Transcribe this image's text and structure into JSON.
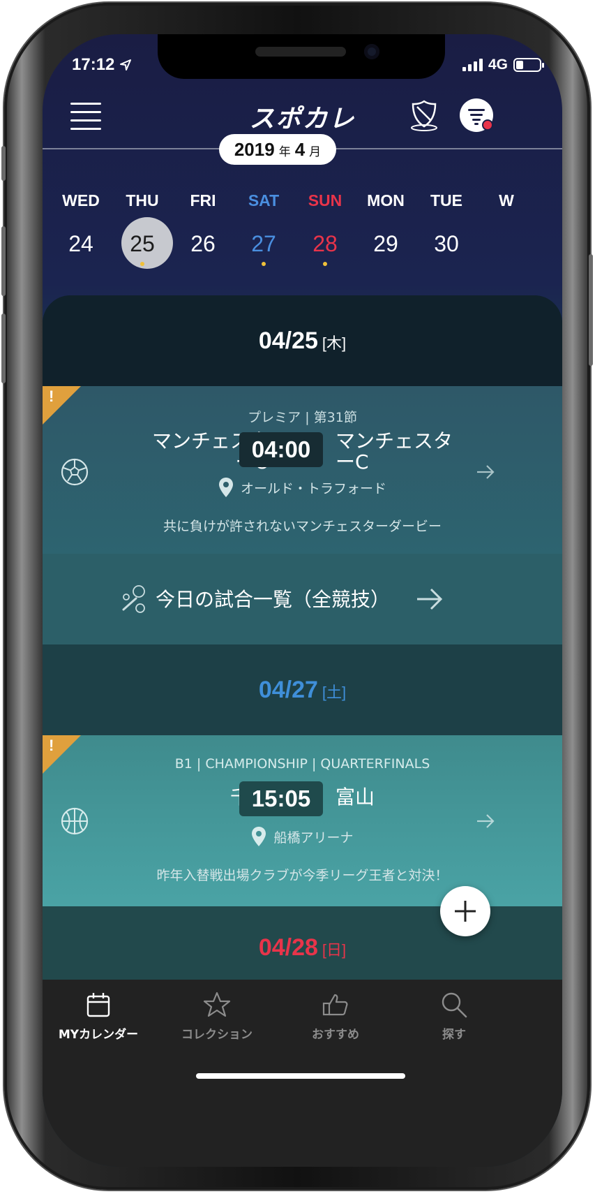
{
  "status_bar": {
    "time": "17:12",
    "network": "4G"
  },
  "header": {
    "logo": "スポカレ",
    "year": "2019",
    "year_unit": "年",
    "month": "4",
    "month_unit": "月"
  },
  "week": [
    {
      "dow": "WED",
      "num": "24",
      "dot": false,
      "type": "normal"
    },
    {
      "dow": "THU",
      "num": "25",
      "dot": true,
      "type": "selected"
    },
    {
      "dow": "FRI",
      "num": "26",
      "dot": false,
      "type": "normal"
    },
    {
      "dow": "SAT",
      "num": "27",
      "dot": true,
      "type": "sat"
    },
    {
      "dow": "SUN",
      "num": "28",
      "dot": true,
      "type": "sun"
    },
    {
      "dow": "MON",
      "num": "29",
      "dot": false,
      "type": "normal"
    },
    {
      "dow": "TUE",
      "num": "30",
      "dot": false,
      "type": "normal"
    },
    {
      "dow": "W",
      "num": "",
      "dot": false,
      "type": "normal"
    }
  ],
  "sections": [
    {
      "date": "04/25",
      "weekday": "[木]",
      "color": "#ffffff",
      "event": {
        "flag": "!",
        "league": "プレミア | 第31節",
        "home_line1": "マンチェスタ",
        "home_line2": "ーU",
        "time": "04:00",
        "away_line1": "マンチェスタ",
        "away_line2": "ーC",
        "venue": "オールド・トラフォード",
        "description": "共に負けが許されないマンチェスターダービー",
        "sport_icon": "soccer-ball-icon"
      }
    },
    {
      "date": "04/27",
      "weekday": "[土]",
      "color": "#3f8fd9",
      "event": {
        "flag": "!",
        "league": "B1 | CHAMPIONSHIP | QUARTERFINALS",
        "home_line1": "千葉",
        "home_line2": "",
        "time": "15:05",
        "away_line1": "富山",
        "away_line2": "",
        "venue": "船橋アリーナ",
        "description": "昨年入替戦出場クラブが今季リーグ王者と対決！",
        "sport_icon": "basketball-icon"
      }
    },
    {
      "date": "04/28",
      "weekday": "[日]",
      "color": "#e8344a"
    }
  ],
  "all_games": {
    "label": "今日の試合一覧（全競技）"
  },
  "tabs": [
    {
      "label": "MYカレンダー",
      "icon": "calendar-icon",
      "active": true
    },
    {
      "label": "コレクション",
      "icon": "star-icon",
      "active": false
    },
    {
      "label": "おすすめ",
      "icon": "thumbs-up-icon",
      "active": false
    },
    {
      "label": "探す",
      "icon": "search-icon",
      "active": false
    }
  ]
}
